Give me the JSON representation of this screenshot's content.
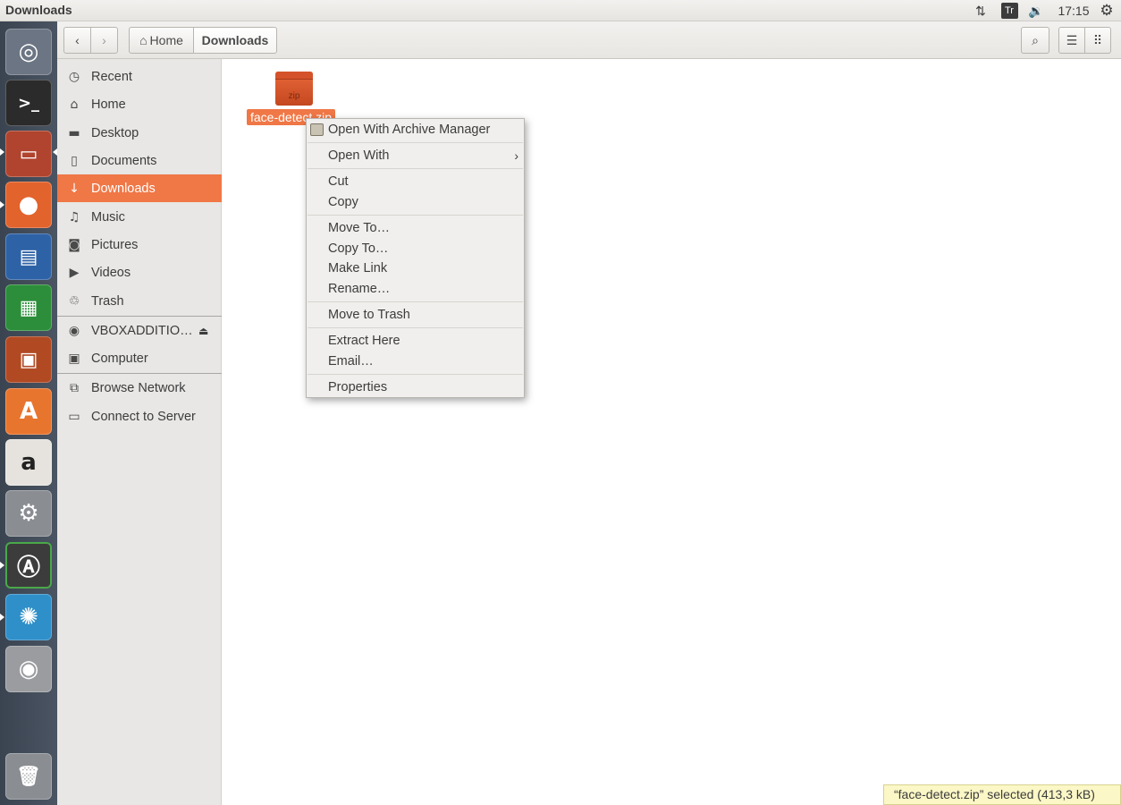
{
  "top_panel": {
    "window_title": "Downloads",
    "keyboard_indicator": "Tr",
    "clock": "17:15",
    "icons": [
      "network-arrows-icon",
      "keyboard-layout-icon",
      "volume-icon",
      "settings-gear-icon"
    ]
  },
  "launcher": {
    "items": [
      {
        "name": "ubuntu-dash",
        "color": "#6b7583"
      },
      {
        "name": "terminal",
        "color": "#2b2b2b"
      },
      {
        "name": "files",
        "color": "#b0442e"
      },
      {
        "name": "firefox",
        "color": "#e2632c"
      },
      {
        "name": "libreoffice-writer",
        "color": "#2e62a6"
      },
      {
        "name": "libreoffice-calc",
        "color": "#2c8e3a"
      },
      {
        "name": "libreoffice-impress",
        "color": "#b14a23"
      },
      {
        "name": "ubuntu-software",
        "color": "#e8752e"
      },
      {
        "name": "amazon",
        "color": "#e6e3de"
      },
      {
        "name": "system-settings",
        "color": "#8a8d92"
      },
      {
        "name": "software-updater",
        "color": "#3c3c3c"
      },
      {
        "name": "unknown-app",
        "color": "#2f8fc9"
      },
      {
        "name": "dvd",
        "color": "#9a9ca0"
      },
      {
        "name": "trash",
        "color": "#8a8d92"
      }
    ]
  },
  "header": {
    "breadcrumb_home": "Home",
    "breadcrumb_current": "Downloads"
  },
  "sidebar": {
    "places": [
      {
        "label": "Recent",
        "icon": "clock-icon"
      },
      {
        "label": "Home",
        "icon": "home-icon"
      },
      {
        "label": "Desktop",
        "icon": "folder-icon"
      },
      {
        "label": "Documents",
        "icon": "document-icon"
      },
      {
        "label": "Downloads",
        "icon": "download-icon",
        "active": true
      },
      {
        "label": "Music",
        "icon": "music-icon"
      },
      {
        "label": "Pictures",
        "icon": "camera-icon"
      },
      {
        "label": "Videos",
        "icon": "video-icon"
      },
      {
        "label": "Trash",
        "icon": "trash-icon"
      }
    ],
    "devices": [
      {
        "label": "VBOXADDITIO…",
        "icon": "disc-icon"
      },
      {
        "label": "Computer",
        "icon": "computer-icon"
      }
    ],
    "network": [
      {
        "label": "Browse Network",
        "icon": "network-icon"
      },
      {
        "label": "Connect to Server",
        "icon": "server-icon"
      }
    ]
  },
  "content": {
    "file": {
      "name": "face-detect.zip",
      "type_label": "zip"
    }
  },
  "context_menu": {
    "items": [
      "Open With Archive Manager",
      "Open With",
      "Cut",
      "Copy",
      "Move To…",
      "Copy To…",
      "Make Link",
      "Rename…",
      "Move to Trash",
      "Extract Here",
      "Email…",
      "Properties"
    ]
  },
  "status": {
    "text": "“face-detect.zip” selected  (413,3 kB)"
  },
  "colors": {
    "accent": "#f07746",
    "launcher_bg": "#3f4855",
    "sidebar_bg": "#e8e7e5",
    "status_bg": "#fbf7c6"
  }
}
